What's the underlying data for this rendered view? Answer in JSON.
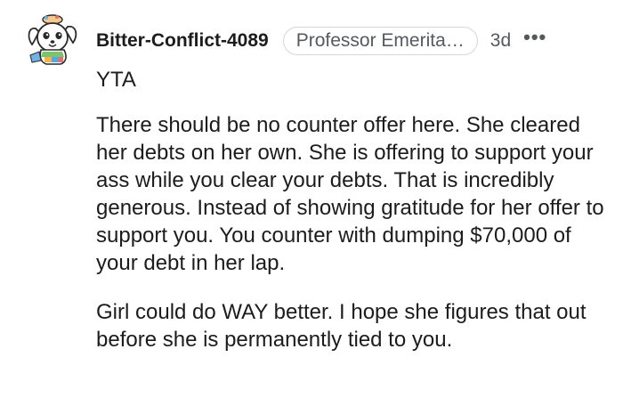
{
  "comment": {
    "author": "Bitter-Conflict-4089",
    "flair": "Professor Emerita…",
    "timestamp": "3d",
    "more_icon": "more-horizontal-icon",
    "avatar_icon": "cartoon-dog-avatar",
    "paragraphs": [
      "YTA",
      "There should be no counter offer here. She cleared her debts on her own. She is offering to support your ass while you clear your debts. That is incredibly generous. Instead of showing gratitude for her offer to support you. You counter with dumping $70,000 of your debt in her lap.",
      "Girl could do WAY better. I hope she figures that out before she is permanently tied to you."
    ]
  }
}
